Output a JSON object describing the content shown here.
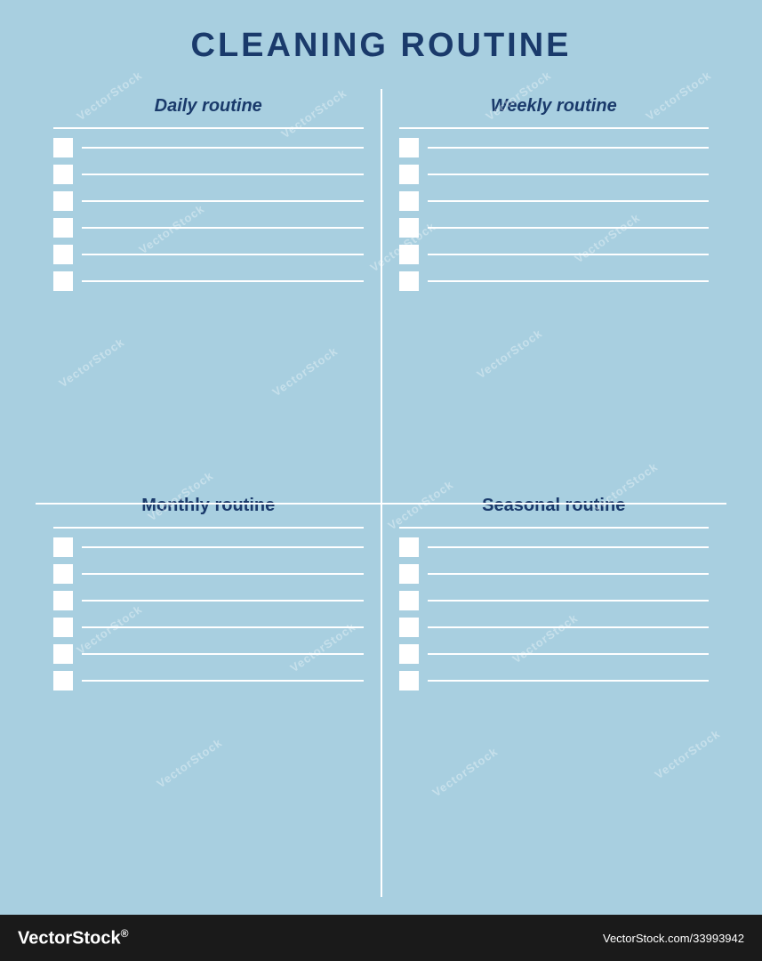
{
  "page": {
    "title": "CLEANING ROUTINE",
    "background_color": "#a8cfe0"
  },
  "sections": [
    {
      "id": "daily",
      "title": "Daily routine",
      "items": 6
    },
    {
      "id": "weekly",
      "title": "Weekly routine",
      "items": 6
    },
    {
      "id": "monthly",
      "title": "Monthly routine",
      "items": 6
    },
    {
      "id": "seasonal",
      "title": "Seasonal routine",
      "items": 6
    }
  ],
  "footer": {
    "brand": "VectorStock",
    "reg_symbol": "®",
    "url": "VectorStock.com/33993942"
  },
  "watermarks": [
    "VectorStock",
    "VectorStock",
    "VectorStock",
    "VectorStock",
    "VectorStock",
    "VectorStock",
    "VectorStock",
    "VectorStock",
    "VectorStock",
    "VectorStock",
    "VectorStock",
    "VectorStock"
  ]
}
